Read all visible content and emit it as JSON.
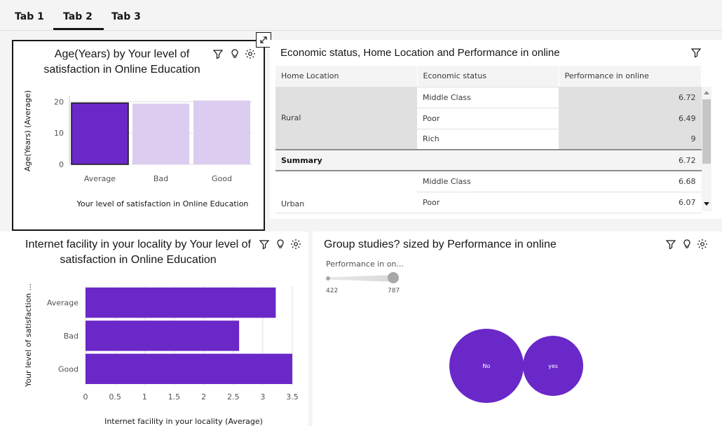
{
  "tabs": [
    "Tab 1",
    "Tab 2",
    "Tab 3"
  ],
  "active_tab": 1,
  "colors": {
    "accent": "#6a28c8",
    "light": "#dccdf0"
  },
  "card1": {
    "title_line1": "Age(Years) by Your level of",
    "title_line2": "satisfaction in Online Education",
    "expand_icon": "expand-icon",
    "chart_data": {
      "type": "bar",
      "categories": [
        "Average",
        "Bad",
        "Good"
      ],
      "values": [
        19.6,
        19.4,
        20.4
      ],
      "xlabel": "Your level of satisfaction in Online Education",
      "ylabel": "Age(Years) (Average)",
      "ylim": [
        0,
        21
      ],
      "yticks": [
        0,
        10,
        20
      ],
      "grid": true,
      "highlighted": "Average"
    }
  },
  "card2": {
    "title": "Economic status, Home Location and Performance in online",
    "headers": [
      "Home Location",
      "Economic status",
      "Performance in online"
    ],
    "rows": [
      {
        "loc": "",
        "status": "Middle Class",
        "value": "6.72"
      },
      {
        "loc": "Rural",
        "status": "Poor",
        "value": "6.49"
      },
      {
        "loc": "",
        "status": "Rich",
        "value": "9"
      },
      {
        "loc": "Summary",
        "status": "",
        "value": "6.72"
      },
      {
        "loc": "",
        "status": "Middle Class",
        "value": "6.68"
      },
      {
        "loc": "Urban",
        "status": "Poor",
        "value": "6.07"
      }
    ]
  },
  "card3": {
    "title_line1": "Internet facility in your locality by Your level of",
    "title_line2": "satisfaction in Online Education",
    "chart_data": {
      "type": "bar",
      "orientation": "horizontal",
      "categories": [
        "Average",
        "Bad",
        "Good"
      ],
      "values": [
        3.22,
        2.6,
        3.5
      ],
      "xlabel": "Internet facility in your locality (Average)",
      "ylabel": "Your level of satisfaction ...",
      "xlim": [
        0,
        3.5
      ],
      "xticks": [
        "0",
        "0.5",
        "1",
        "1.5",
        "2",
        "2.5",
        "3",
        "3.5"
      ],
      "grid": true
    }
  },
  "card4": {
    "title": "Group studies? sized by Performance in online",
    "slider": {
      "label": "Performance in on...",
      "min": "422",
      "max": "787"
    },
    "chart_data": {
      "type": "bubble",
      "categories": [
        "No",
        "yes"
      ],
      "size_label": "Performance in online",
      "size_range": [
        422,
        787
      ]
    }
  }
}
